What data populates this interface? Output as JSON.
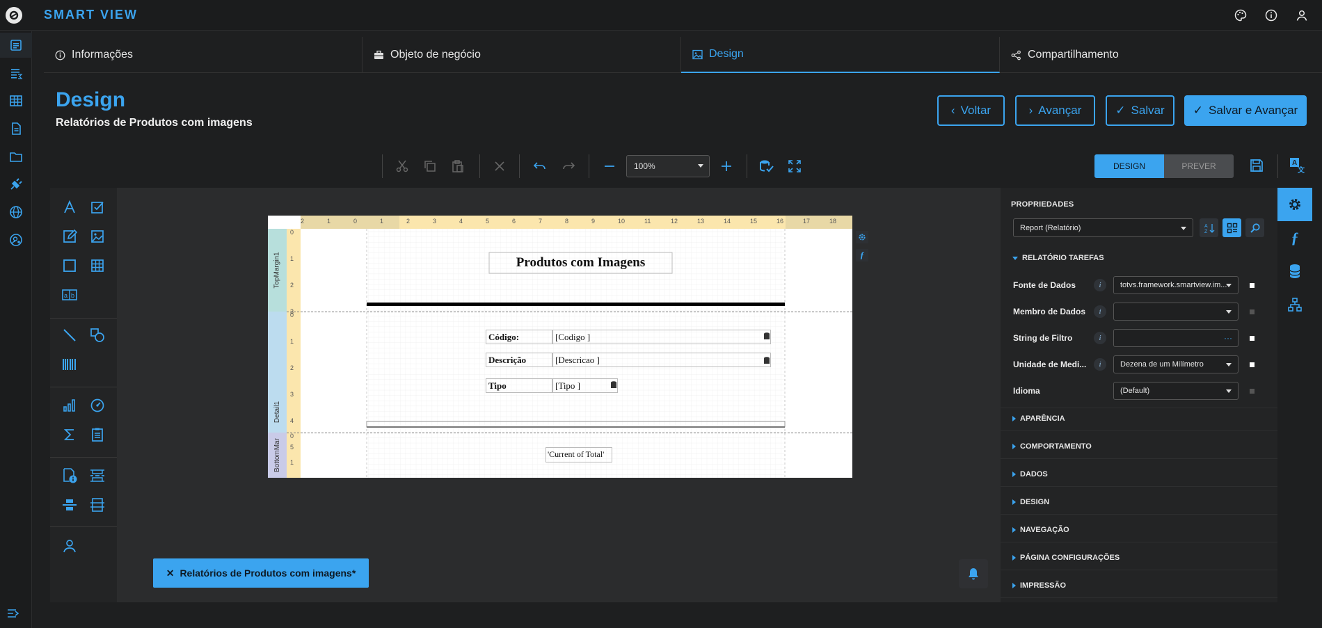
{
  "app": {
    "brand": "SMART VIEW"
  },
  "tabs": [
    {
      "label": "Informações",
      "icon": "info-icon"
    },
    {
      "label": "Objeto de negócio",
      "icon": "briefcase-icon"
    },
    {
      "label": "Design",
      "icon": "image-icon",
      "active": true
    },
    {
      "label": "Compartilhamento",
      "icon": "share-icon"
    }
  ],
  "page": {
    "title": "Design",
    "subtitle": "Relatórios de Produtos com imagens"
  },
  "actions": {
    "back": "Voltar",
    "next": "Avançar",
    "save": "Salvar",
    "save_next": "Salvar e Avançar"
  },
  "toolbar": {
    "zoom": "100%"
  },
  "modes": {
    "design": "DESIGN",
    "preview": "PREVER"
  },
  "report": {
    "title": "Produtos com Imagens",
    "bands": [
      "TopMargin1",
      "Detail1",
      "BottomMar"
    ],
    "labels": [
      "Código:",
      "Descrição",
      "Tipo"
    ],
    "fields": [
      "[Codigo      ]",
      "[Descricao   ]",
      "[Tipo       ]"
    ],
    "footer": "'Current of Total'",
    "ruler_top": [
      "2",
      "1",
      "0",
      "1",
      "2",
      "3",
      "4",
      "5",
      "6",
      "7",
      "8",
      "9",
      "10",
      "11",
      "12",
      "13",
      "14",
      "15",
      "16",
      "17",
      "18"
    ],
    "ruler_left_top": [
      "0",
      "1",
      "2",
      "3"
    ],
    "ruler_left_detail": [
      "0",
      "1",
      "2",
      "3",
      "4",
      "5"
    ],
    "ruler_left_bottom": [
      "0",
      "1"
    ]
  },
  "properties": {
    "header": "PROPRIEDADES",
    "object": "Report (Relatório)",
    "tasks_section": "RELATÓRIO TAREFAS",
    "rows": [
      {
        "name": "Fonte de Dados",
        "value": "totvs.framework.smartview.im...",
        "kind": "dropdown"
      },
      {
        "name": "Membro de Dados",
        "value": "",
        "kind": "dropdown"
      },
      {
        "name": "String de Filtro",
        "value": "",
        "kind": "ellipsis"
      },
      {
        "name": "Unidade de Medi...",
        "value": "Dezena de um Milímetro",
        "kind": "dropdown"
      },
      {
        "name": "Idioma",
        "value": "(Default)",
        "kind": "dropdown"
      }
    ],
    "sections": [
      "APARÊNCIA",
      "COMPORTAMENTO",
      "DADOS",
      "DESIGN",
      "NAVEGAÇÃO",
      "PÁGINA CONFIGURAÇÕES",
      "IMPRESSÃO"
    ]
  },
  "document_tab": "Relatórios de Produtos com imagens*",
  "colors": {
    "accent": "#3ba4ef",
    "background": "#1e1f20"
  }
}
